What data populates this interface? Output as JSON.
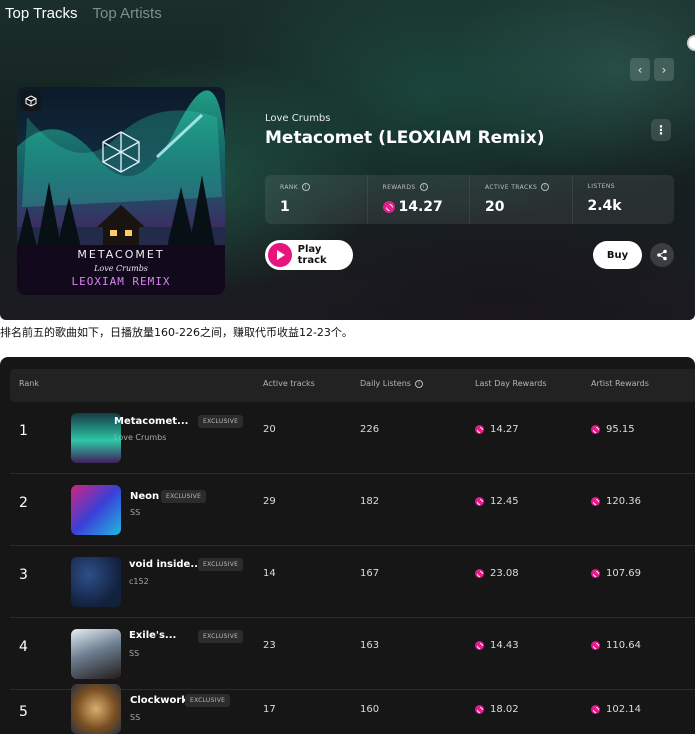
{
  "hero": {
    "tabs": [
      {
        "label": "Top Tracks",
        "active": true
      },
      {
        "label": "Top Artists",
        "active": false
      }
    ],
    "nav": {
      "prev_icon": "chevron-left-icon",
      "next_icon": "chevron-right-icon",
      "prev": "‹",
      "next": "›"
    },
    "cover": {
      "title": "METACOMET",
      "artist": "Love Crumbs",
      "remix": "LEOXIAM REMIX"
    },
    "artist": "Love Crumbs",
    "title": "Metacomet (LEOXIAM Remix)",
    "more": "⋮",
    "stats": [
      {
        "label": "RANK",
        "value": "1"
      },
      {
        "label": "REWARDS",
        "value": "14.27"
      },
      {
        "label": "ACTIVE TRACKS",
        "value": "20"
      },
      {
        "label": "LISTENS",
        "value": "2.4k"
      }
    ],
    "play_label": "Play track",
    "buy_label": "Buy"
  },
  "caption": "排名前五的歌曲如下，日播放量160-226之间，赚取代币收益12-23个。",
  "table": {
    "headers": {
      "rank": "Rank",
      "active_tracks": "Active tracks",
      "daily_listens": "Daily Listens",
      "last_day_rewards": "Last Day Rewards",
      "artist_rewards": "Artist Rewards"
    },
    "exclusive_label": "EXCLUSIVE",
    "rows": [
      {
        "rank": "1",
        "title": "Metacomet...",
        "artist": "Love Crumbs",
        "active_tracks": "20",
        "daily_listens": "226",
        "last_day_rewards": "14.27",
        "artist_rewards": "95.15"
      },
      {
        "rank": "2",
        "title": "Neon",
        "artist": "SS",
        "active_tracks": "29",
        "daily_listens": "182",
        "last_day_rewards": "12.45",
        "artist_rewards": "120.36"
      },
      {
        "rank": "3",
        "title": "void inside...",
        "artist": "c152",
        "active_tracks": "14",
        "daily_listens": "167",
        "last_day_rewards": "23.08",
        "artist_rewards": "107.69"
      },
      {
        "rank": "4",
        "title": "Exile's...",
        "artist": "SS",
        "active_tracks": "23",
        "daily_listens": "163",
        "last_day_rewards": "14.43",
        "artist_rewards": "110.64"
      },
      {
        "rank": "5",
        "title": "Clockwork",
        "artist": "SS",
        "active_tracks": "17",
        "daily_listens": "160",
        "last_day_rewards": "18.02",
        "artist_rewards": "102.14"
      }
    ]
  },
  "colors": {
    "accent": "#e8147e",
    "panel": "#161616",
    "header_row": "#222222"
  }
}
